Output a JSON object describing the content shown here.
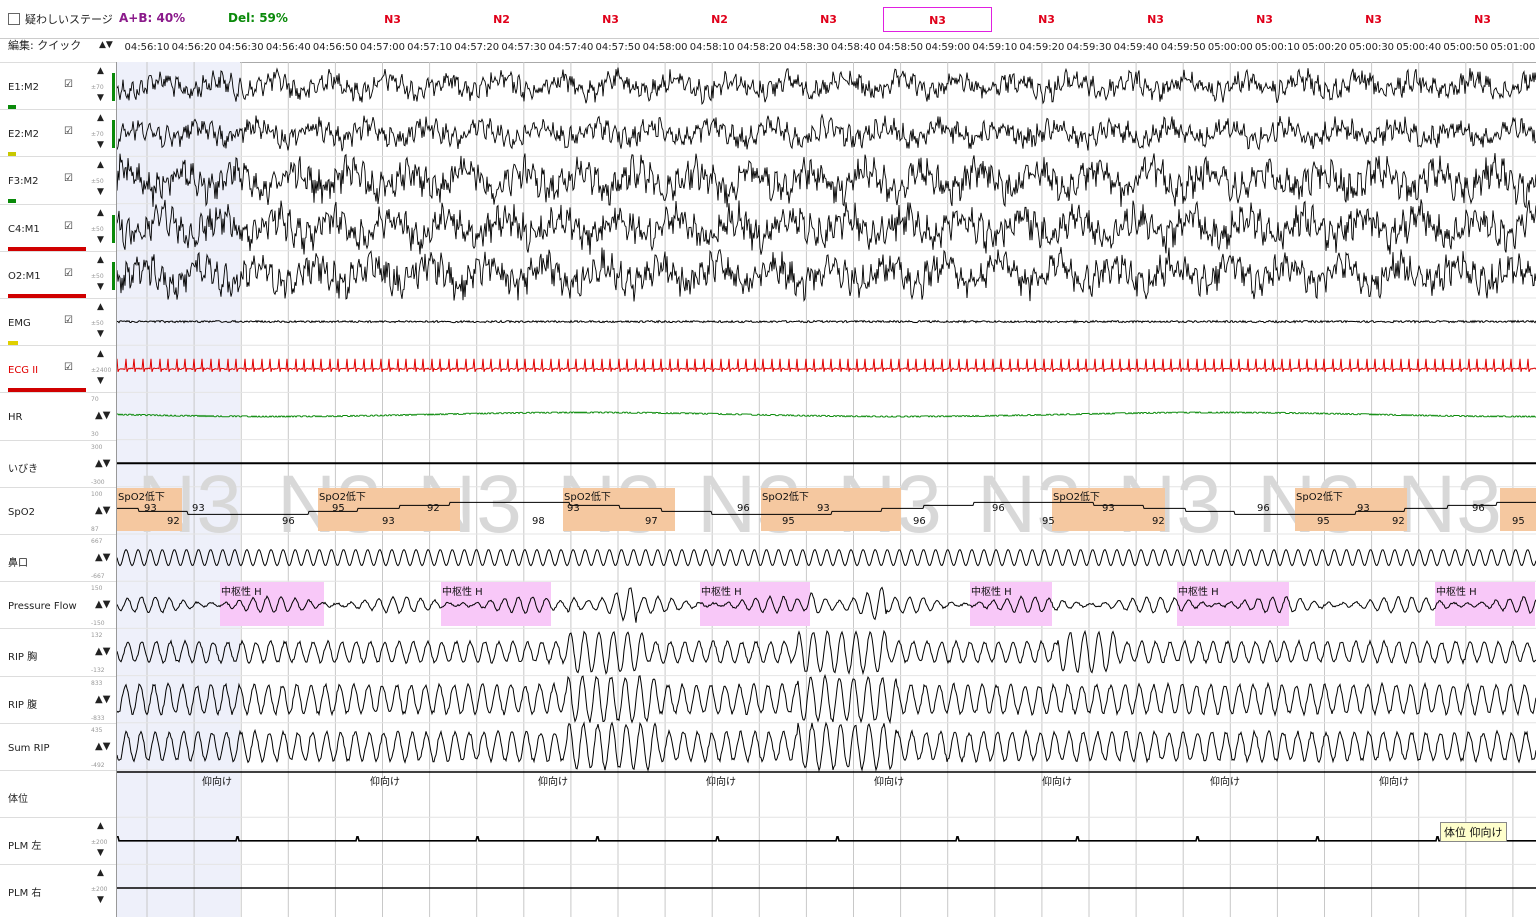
{
  "header": {
    "suspect_label": "疑わしいステージ",
    "ab_label": "A+B: 40%",
    "del_label": "Del: 59%",
    "edit_label": "編集: クイック",
    "epochs": [
      "N3",
      "N2",
      "N3",
      "N2",
      "N3",
      "N3",
      "N3",
      "N3",
      "N3",
      "N3",
      "N3"
    ],
    "selected_epoch_index": 5,
    "times": [
      "04:56:10",
      "04:56:20",
      "04:56:30",
      "04:56:40",
      "04:56:50",
      "04:57:00",
      "04:57:10",
      "04:57:20",
      "04:57:30",
      "04:57:40",
      "04:57:50",
      "04:58:00",
      "04:58:10",
      "04:58:20",
      "04:58:30",
      "04:58:40",
      "04:58:50",
      "04:59:00",
      "04:59:10",
      "04:59:20",
      "04:59:30",
      "04:59:40",
      "04:59:50",
      "05:00:00",
      "05:00:10",
      "05:00:20",
      "05:00:30",
      "05:00:40",
      "05:00:50",
      "05:01:00"
    ]
  },
  "channels": [
    {
      "name": "E1:M2",
      "check": true,
      "scale": "±70",
      "color": "#000000",
      "gain_color": "#0a8a0a",
      "active": true
    },
    {
      "name": "E2:M2",
      "check": true,
      "scale": "±70",
      "color": "#000000",
      "gain_color": "#c8c800",
      "active": true
    },
    {
      "name": "F3:M2",
      "check": true,
      "scale": "±50",
      "color": "#000000",
      "gain_color": "#0a8a0a",
      "active": false
    },
    {
      "name": "C4:M1",
      "check": true,
      "scale": "±50",
      "color": "#000000",
      "gain_color": "#d00000",
      "active": true
    },
    {
      "name": "O2:M1",
      "check": true,
      "scale": "±50",
      "color": "#000000",
      "gain_color": "#d00000",
      "active": true
    },
    {
      "name": "EMG",
      "check": true,
      "scale": "±50",
      "color": "#000000",
      "gain_color": "#e0d000",
      "active": false
    },
    {
      "name": "ECG II",
      "check": true,
      "scale": "±2400",
      "color": "#e00000",
      "gain_color": "#d00000",
      "active": false
    },
    {
      "name": "HR",
      "check": false,
      "scale_top": "70",
      "scale_bot": "30",
      "color": "#0a8a0a",
      "gain_color": "",
      "active": false
    },
    {
      "name": "いびき",
      "check": false,
      "scale_top": "300",
      "scale_bot": "-300",
      "color": "#000000",
      "gain_color": "",
      "active": false
    },
    {
      "name": "SpO2",
      "check": false,
      "scale_top": "100",
      "scale_bot": "87",
      "color": "#000000",
      "gain_color": "",
      "active": false
    },
    {
      "name": "鼻口",
      "check": false,
      "scale_top": "667",
      "scale_bot": "-667",
      "color": "#000000",
      "gain_color": "",
      "active": false
    },
    {
      "name": "Pressure Flow",
      "check": false,
      "scale_top": "150",
      "scale_bot": "-150",
      "color": "#000000",
      "gain_color": "",
      "active": false
    },
    {
      "name": "RIP 胸",
      "check": false,
      "scale_top": "132",
      "scale_bot": "-132",
      "color": "#000000",
      "gain_color": "",
      "active": false
    },
    {
      "name": "RIP 腹",
      "check": false,
      "scale_top": "833",
      "scale_bot": "-833",
      "color": "#000000",
      "gain_color": "",
      "active": false
    },
    {
      "name": "Sum RIP",
      "check": false,
      "scale_top": "435",
      "scale_bot": "-492",
      "color": "#000000",
      "gain_color": "",
      "active": false
    },
    {
      "name": "体位",
      "check": false,
      "color": "#000000",
      "gain_color": "",
      "active": false
    },
    {
      "name": "PLM 左",
      "check": false,
      "scale": "±200",
      "color": "#000000",
      "gain_color": "",
      "active": false
    },
    {
      "name": "PLM 右",
      "check": false,
      "scale": "±200",
      "color": "#000000",
      "gain_color": "",
      "active": false
    }
  ],
  "watermark": "N3",
  "spo2_event_label": "SpO2低下",
  "spo2_values": [
    "93",
    "92",
    "93",
    "96",
    "95",
    "93",
    "92",
    "98",
    "93",
    "97",
    "96",
    "95",
    "93",
    "96",
    "96",
    "95",
    "93",
    "92",
    "96",
    "95",
    "93",
    "92",
    "96",
    "95"
  ],
  "central_hypopnea_label": "中枢性 H",
  "body_position_label": "仰向け",
  "tooltip": "体位 仰向け",
  "colors": {
    "stage_red": "#e0001a",
    "ab_purple": "#8b1a8b",
    "del_green": "#0a8a0a",
    "spo2_event": "#f5c8a0",
    "hypopnea_event": "#f8c8f8",
    "selection_shade": "#eef0fa"
  }
}
